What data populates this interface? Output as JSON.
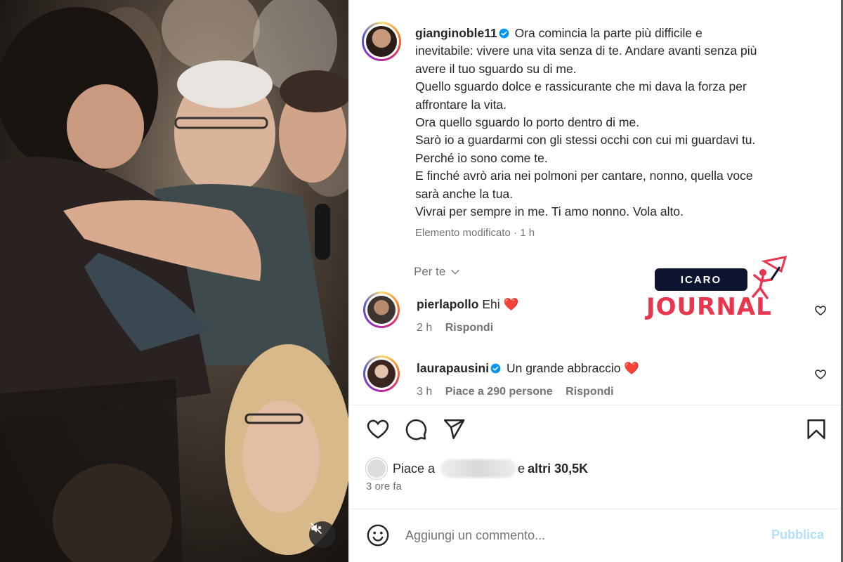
{
  "post": {
    "username": "gianginoble11",
    "caption_lines": [
      "Ora comincia la parte più difficile e",
      "inevitabile: vivere una vita senza di te. Andare avanti senza più",
      "avere il tuo sguardo su di me.",
      "Quello sguardo dolce e rassicurante che mi dava la forza per",
      "affrontare la vita.",
      "Ora quello sguardo lo porto dentro di me.",
      "Sarò io a guardarmi con gli stessi occhi con cui mi guardavi tu.",
      "Perché io sono come te.",
      "E finché avrò aria nei polmoni per cantare, nonno, quella voce",
      "sarà anche la tua.",
      "Vivrai per sempre in me. Ti amo nonno. Vola alto."
    ],
    "edited_meta": "Elemento modificato · 1 h"
  },
  "filter": {
    "label": "Per te"
  },
  "comments": [
    {
      "username": "pierlapollo",
      "text": "Ehi ❤️",
      "time": "2 h",
      "likes": "",
      "reply": "Rispondi"
    },
    {
      "username": "laurapausini",
      "text": "Un grande abbraccio ❤️",
      "time": "3 h",
      "likes": "Piace a 290 persone",
      "reply": "Rispondi"
    }
  ],
  "watermark": {
    "top": "ICARO",
    "bottom": "JOURNAL"
  },
  "likes": {
    "prefix": "Piace a",
    "middle": "e",
    "rest": "altri 30,5K"
  },
  "posted_ago": "3 ore fa",
  "comment_box": {
    "placeholder": "Aggiungi un commento...",
    "publish": "Pubblica"
  },
  "colors": {
    "verified": "#0095f6",
    "heart_red": "#ed4956",
    "publish_disabled": "#b2dffc",
    "brand_red": "#e8364f",
    "brand_navy": "#0e1530"
  },
  "icons": [
    "heart-icon",
    "comment-icon",
    "share-icon",
    "bookmark-icon",
    "emoji-icon",
    "mute-icon",
    "chevron-down-icon",
    "verified-icon"
  ]
}
